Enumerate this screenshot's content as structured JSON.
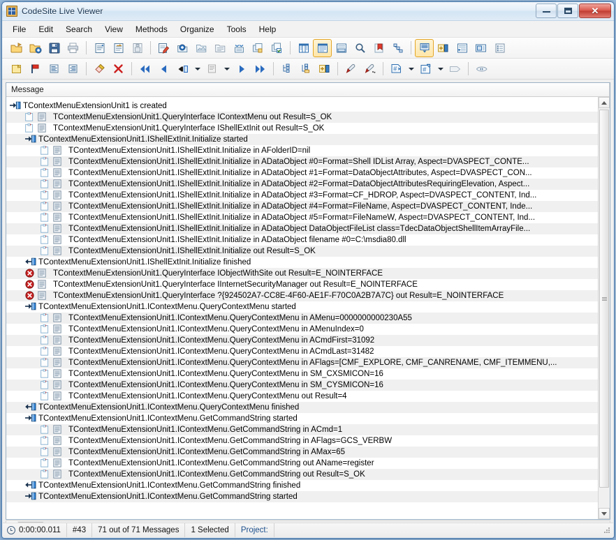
{
  "window": {
    "title": "CodeSite Live Viewer",
    "icon": "codesite-app-icon",
    "buttons": {
      "minimize": "minimize-button",
      "maximize": "maximize-button",
      "close": "close-button"
    }
  },
  "menu": {
    "items": [
      "File",
      "Edit",
      "Search",
      "View",
      "Methods",
      "Organize",
      "Tools",
      "Help"
    ]
  },
  "toolbar1": {
    "items": [
      {
        "name": "open-folder-icon",
        "kind": "icon"
      },
      {
        "name": "open-folder-add-icon",
        "kind": "icon"
      },
      {
        "name": "save-icon",
        "kind": "icon"
      },
      {
        "name": "print-icon",
        "kind": "icon"
      },
      {
        "name": "separator",
        "kind": "sep"
      },
      {
        "name": "new-message-list-icon",
        "kind": "icon"
      },
      {
        "name": "open-message-list-icon",
        "kind": "icon"
      },
      {
        "name": "save-message-list-icon",
        "kind": "icon"
      },
      {
        "name": "separator",
        "kind": "sep"
      },
      {
        "name": "clear-log-icon",
        "kind": "icon"
      },
      {
        "name": "add-category-icon",
        "kind": "icon"
      },
      {
        "name": "open-category-icon",
        "kind": "icon"
      },
      {
        "name": "close-category-icon",
        "kind": "icon"
      },
      {
        "name": "expand-all-icon",
        "kind": "icon"
      },
      {
        "name": "collapse-group-icon",
        "kind": "icon"
      },
      {
        "name": "check-group-icon",
        "kind": "icon"
      },
      {
        "name": "separator",
        "kind": "sep"
      },
      {
        "name": "columns-view-icon",
        "kind": "icon"
      },
      {
        "name": "list-view-icon",
        "kind": "icon",
        "active": true
      },
      {
        "name": "detail-pane-icon",
        "kind": "icon"
      },
      {
        "name": "find-icon",
        "kind": "icon"
      },
      {
        "name": "bookmark-icon",
        "kind": "icon"
      },
      {
        "name": "call-stack-icon",
        "kind": "icon"
      },
      {
        "name": "separator",
        "kind": "sep"
      },
      {
        "name": "message-detail-icon",
        "kind": "icon",
        "active": true
      },
      {
        "name": "add-pane-icon",
        "kind": "icon"
      },
      {
        "name": "indent-view-icon",
        "kind": "icon"
      },
      {
        "name": "preview-pane-icon",
        "kind": "icon"
      },
      {
        "name": "properties-icon",
        "kind": "icon"
      }
    ]
  },
  "toolbar2": {
    "items": [
      {
        "name": "note-icon",
        "kind": "icon"
      },
      {
        "name": "flag-icon",
        "kind": "icon"
      },
      {
        "name": "message-left-icon",
        "kind": "icon"
      },
      {
        "name": "message-right-icon",
        "kind": "icon"
      },
      {
        "name": "separator",
        "kind": "sep"
      },
      {
        "name": "eraser-icon",
        "kind": "icon"
      },
      {
        "name": "delete-icon",
        "kind": "icon"
      },
      {
        "name": "separator",
        "kind": "sep"
      },
      {
        "name": "first-message-icon",
        "kind": "icon"
      },
      {
        "name": "previous-message-icon",
        "kind": "icon"
      },
      {
        "name": "prev-marked-icon",
        "kind": "icon"
      },
      {
        "name": "prev-dropdown-caret",
        "kind": "caret"
      },
      {
        "name": "current-message-icon",
        "kind": "icon"
      },
      {
        "name": "current-dropdown-caret",
        "kind": "caret"
      },
      {
        "name": "next-message-icon",
        "kind": "icon"
      },
      {
        "name": "last-message-icon",
        "kind": "icon"
      },
      {
        "name": "separator",
        "kind": "sep"
      },
      {
        "name": "group-tree-icon",
        "kind": "icon"
      },
      {
        "name": "sort-tree-icon",
        "kind": "icon"
      },
      {
        "name": "add-column-icon",
        "kind": "icon"
      },
      {
        "name": "separator",
        "kind": "sep"
      },
      {
        "name": "marker-icon",
        "kind": "icon"
      },
      {
        "name": "marker-clear-icon",
        "kind": "icon"
      },
      {
        "name": "separator",
        "kind": "sep"
      },
      {
        "name": "goto-number-icon",
        "kind": "icon"
      },
      {
        "name": "goto-number-caret",
        "kind": "caret"
      },
      {
        "name": "goto-next-number-icon",
        "kind": "icon"
      },
      {
        "name": "goto-next-caret",
        "kind": "caret"
      },
      {
        "name": "tag-icon",
        "kind": "icon"
      },
      {
        "name": "separator",
        "kind": "sep"
      },
      {
        "name": "watch-icon",
        "kind": "icon"
      }
    ]
  },
  "list": {
    "column_header": "Message",
    "rows": [
      {
        "indent": 0,
        "icon": "enter-method",
        "text": "TContextMenuExtensionUnit1 is created"
      },
      {
        "indent": 1,
        "icon": "note",
        "text": "TContextMenuExtensionUnit1.QueryInterface IContextMenu out Result=S_OK"
      },
      {
        "indent": 1,
        "icon": "note",
        "text": "TContextMenuExtensionUnit1.QueryInterface IShellExtInit out Result=S_OK"
      },
      {
        "indent": 1,
        "icon": "enter-method",
        "text": "TContextMenuExtensionUnit1.IShellExtInit.Initialize started"
      },
      {
        "indent": 2,
        "icon": "note",
        "text": "TContextMenuExtensionUnit1.IShellExtInit.Initialize in AFolderID=nil"
      },
      {
        "indent": 2,
        "icon": "note",
        "text": "TContextMenuExtensionUnit1.IShellExtInit.Initialize in ADataObject #0=Format=Shell IDList Array, Aspect=DVASPECT_CONTE..."
      },
      {
        "indent": 2,
        "icon": "note",
        "text": "TContextMenuExtensionUnit1.IShellExtInit.Initialize in ADataObject #1=Format=DataObjectAttributes, Aspect=DVASPECT_CON..."
      },
      {
        "indent": 2,
        "icon": "note",
        "text": "TContextMenuExtensionUnit1.IShellExtInit.Initialize in ADataObject #2=Format=DataObjectAttributesRequiringElevation, Aspect..."
      },
      {
        "indent": 2,
        "icon": "note",
        "text": "TContextMenuExtensionUnit1.IShellExtInit.Initialize in ADataObject #3=Format=CF_HDROP, Aspect=DVASPECT_CONTENT, Ind..."
      },
      {
        "indent": 2,
        "icon": "note",
        "text": "TContextMenuExtensionUnit1.IShellExtInit.Initialize in ADataObject #4=Format=FileName, Aspect=DVASPECT_CONTENT, Inde..."
      },
      {
        "indent": 2,
        "icon": "note",
        "text": "TContextMenuExtensionUnit1.IShellExtInit.Initialize in ADataObject #5=Format=FileNameW, Aspect=DVASPECT_CONTENT, Ind..."
      },
      {
        "indent": 2,
        "icon": "note",
        "text": "TContextMenuExtensionUnit1.IShellExtInit.Initialize in ADataObject DataObjectFileList class=TdecDataObjectShellItemArrayFile..."
      },
      {
        "indent": 2,
        "icon": "note",
        "text": "TContextMenuExtensionUnit1.IShellExtInit.Initialize in ADataObject filename #0=C:\\msdia80.dll"
      },
      {
        "indent": 2,
        "icon": "note",
        "text": "TContextMenuExtensionUnit1.IShellExtInit.Initialize out Result=S_OK"
      },
      {
        "indent": 1,
        "icon": "exit-method",
        "text": "TContextMenuExtensionUnit1.IShellExtInit.Initialize finished"
      },
      {
        "indent": 1,
        "icon": "error",
        "text": "TContextMenuExtensionUnit1.QueryInterface IObjectWithSite out Result=E_NOINTERFACE"
      },
      {
        "indent": 1,
        "icon": "error",
        "text": "TContextMenuExtensionUnit1.QueryInterface IInternetSecurityManager out Result=E_NOINTERFACE"
      },
      {
        "indent": 1,
        "icon": "error",
        "text": "TContextMenuExtensionUnit1.QueryInterface ?{924502A7-CC8E-4F60-AE1F-F70C0A2B7A7C} out Result=E_NOINTERFACE"
      },
      {
        "indent": 1,
        "icon": "enter-method",
        "text": "TContextMenuExtensionUnit1.IContextMenu.QueryContextMenu started"
      },
      {
        "indent": 2,
        "icon": "note",
        "text": "TContextMenuExtensionUnit1.IContextMenu.QueryContextMenu in AMenu=0000000000230A55"
      },
      {
        "indent": 2,
        "icon": "note",
        "text": "TContextMenuExtensionUnit1.IContextMenu.QueryContextMenu in AMenuIndex=0"
      },
      {
        "indent": 2,
        "icon": "note",
        "text": "TContextMenuExtensionUnit1.IContextMenu.QueryContextMenu in ACmdFirst=31092"
      },
      {
        "indent": 2,
        "icon": "note",
        "text": "TContextMenuExtensionUnit1.IContextMenu.QueryContextMenu in ACmdLast=31482"
      },
      {
        "indent": 2,
        "icon": "note",
        "text": "TContextMenuExtensionUnit1.IContextMenu.QueryContextMenu in AFlags=[CMF_EXPLORE, CMF_CANRENAME, CMF_ITEMMENU,..."
      },
      {
        "indent": 2,
        "icon": "note",
        "text": "TContextMenuExtensionUnit1.IContextMenu.QueryContextMenu in SM_CXSMICON=16"
      },
      {
        "indent": 2,
        "icon": "note",
        "text": "TContextMenuExtensionUnit1.IContextMenu.QueryContextMenu in SM_CYSMICON=16"
      },
      {
        "indent": 2,
        "icon": "note",
        "text": "TContextMenuExtensionUnit1.IContextMenu.QueryContextMenu out Result=4"
      },
      {
        "indent": 1,
        "icon": "exit-method",
        "text": "TContextMenuExtensionUnit1.IContextMenu.QueryContextMenu finished"
      },
      {
        "indent": 1,
        "icon": "enter-method",
        "text": "TContextMenuExtensionUnit1.IContextMenu.GetCommandString started"
      },
      {
        "indent": 2,
        "icon": "note",
        "text": "TContextMenuExtensionUnit1.IContextMenu.GetCommandString in ACmd=1"
      },
      {
        "indent": 2,
        "icon": "note",
        "text": "TContextMenuExtensionUnit1.IContextMenu.GetCommandString in AFlags=GCS_VERBW"
      },
      {
        "indent": 2,
        "icon": "note",
        "text": "TContextMenuExtensionUnit1.IContextMenu.GetCommandString in AMax=65"
      },
      {
        "indent": 2,
        "icon": "note",
        "text": "TContextMenuExtensionUnit1.IContextMenu.GetCommandString out AName=register"
      },
      {
        "indent": 2,
        "icon": "note",
        "text": "TContextMenuExtensionUnit1.IContextMenu.GetCommandString out Result=S_OK"
      },
      {
        "indent": 1,
        "icon": "exit-method",
        "text": "TContextMenuExtensionUnit1.IContextMenu.GetCommandString finished"
      },
      {
        "indent": 1,
        "icon": "enter-method",
        "text": "TContextMenuExtensionUnit1.IContextMenu.GetCommandString started"
      }
    ]
  },
  "statusbar": {
    "clock_icon": "clock-icon",
    "elapsed": "0:00:00.011",
    "message_number": "#43",
    "message_count": "71 out of 71 Messages",
    "selection": "1 Selected",
    "project": "Project:"
  }
}
